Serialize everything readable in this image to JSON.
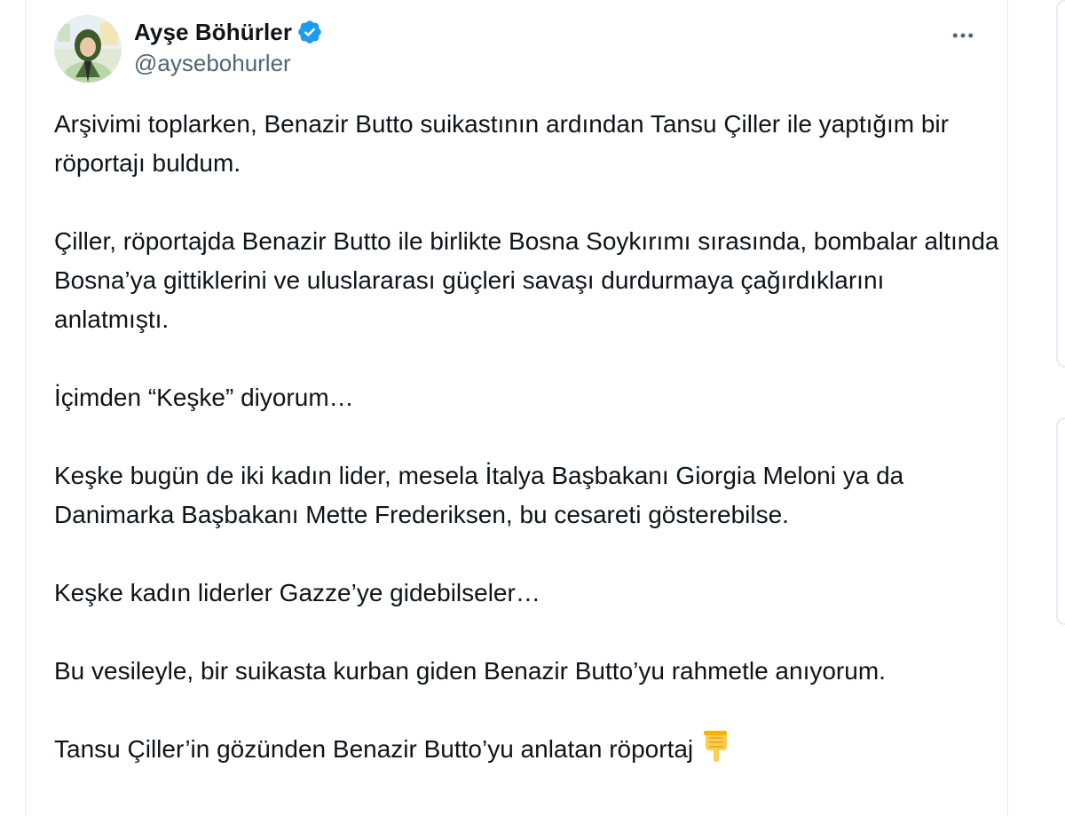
{
  "user": {
    "display_name": "Ayşe Böhürler",
    "handle": "@aysebohurler",
    "verified": true,
    "verified_icon": "verified-badge-icon",
    "verified_color": "#1d9bf0"
  },
  "menu": {
    "more_icon": "more-horizontal-icon"
  },
  "tweet": {
    "paragraphs": [
      "Arşivimi toplarken, Benazir Butto suikastının ardından Tansu Çiller ile yaptığım bir röportajı buldum.",
      "Çiller, röportajda Benazir Butto ile birlikte Bosna Soykırımı sırasında, bombalar altında Bosna’ya gittiklerini ve uluslararası güçleri savaşı durdurmaya çağırdıklarını anlatmıştı.",
      "İçimden “Keşke” diyorum…",
      "Keşke bugün de iki kadın lider, mesela İtalya Başbakanı Giorgia Meloni ya da Danimarka Başbakanı Mette Frederiksen, bu cesareti gösterebilse.",
      "Keşke kadın liderler Gazze’ye gidebilseler…",
      "Bu vesileyle, bir suikasta kurban giden Benazir Butto’yu rahmetle anıyorum.",
      "Tansu Çiller’in gözünden Benazir Butto’yu anlatan röportaj"
    ],
    "final_emoji": "backhand-index-pointing-down-icon"
  },
  "colors": {
    "text": "#0f1419",
    "secondary": "#536471",
    "border": "#e6ecf0"
  }
}
